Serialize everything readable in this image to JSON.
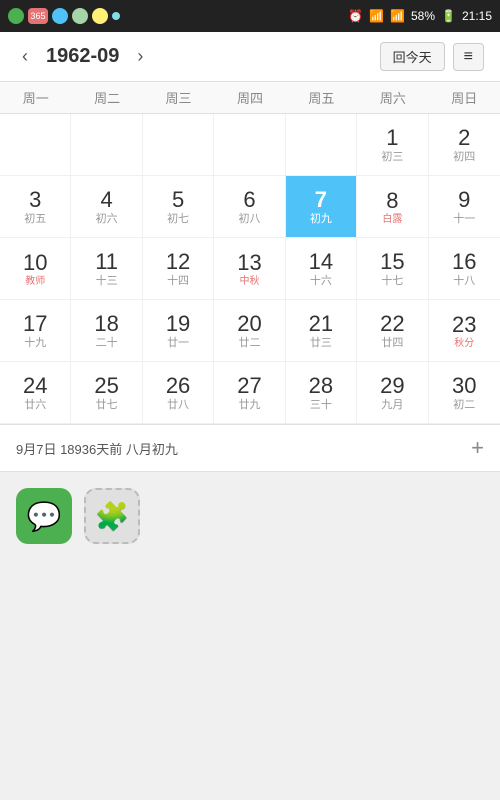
{
  "statusBar": {
    "time": "21:15",
    "battery": "58%",
    "icons": [
      "365",
      "?",
      "leaf",
      "face",
      "wifi"
    ]
  },
  "header": {
    "prevArrow": "‹",
    "nextArrow": "›",
    "monthTitle": "1962-09",
    "todayBtn": "回今天",
    "menuBtn": "≡"
  },
  "weekdays": [
    "周一",
    "周二",
    "周三",
    "周四",
    "周五",
    "周六",
    "周日"
  ],
  "infoBar": {
    "text": "9月7日 18936天前 八月初九",
    "addBtn": "+"
  },
  "days": [
    {
      "num": "",
      "lunar": "",
      "empty": true
    },
    {
      "num": "",
      "lunar": "",
      "empty": true
    },
    {
      "num": "",
      "lunar": "",
      "empty": true
    },
    {
      "num": "",
      "lunar": "",
      "empty": true
    },
    {
      "num": "",
      "lunar": "",
      "empty": true
    },
    {
      "num": "1",
      "lunar": "初三"
    },
    {
      "num": "2",
      "lunar": "初四"
    },
    {
      "num": "3",
      "lunar": "初五"
    },
    {
      "num": "4",
      "lunar": "初六"
    },
    {
      "num": "5",
      "lunar": "初七"
    },
    {
      "num": "6",
      "lunar": "初八"
    },
    {
      "num": "7",
      "lunar": "初九",
      "today": true
    },
    {
      "num": "8",
      "lunar": "白露",
      "festival": "白露"
    },
    {
      "num": "9",
      "lunar": "十一"
    },
    {
      "num": "10",
      "lunar": "教师",
      "festival": "教师"
    },
    {
      "num": "11",
      "lunar": "十三"
    },
    {
      "num": "12",
      "lunar": "十四"
    },
    {
      "num": "13",
      "lunar": "中秋",
      "festival": "中秋"
    },
    {
      "num": "14",
      "lunar": "十六"
    },
    {
      "num": "15",
      "lunar": "十七"
    },
    {
      "num": "16",
      "lunar": "十八"
    },
    {
      "num": "17",
      "lunar": "十九"
    },
    {
      "num": "18",
      "lunar": "二十"
    },
    {
      "num": "19",
      "lunar": "廿一"
    },
    {
      "num": "20",
      "lunar": "廿二"
    },
    {
      "num": "21",
      "lunar": "廿三"
    },
    {
      "num": "22",
      "lunar": "廿四"
    },
    {
      "num": "23",
      "lunar": "秋分",
      "festival": "秋分"
    },
    {
      "num": "24",
      "lunar": "廿六"
    },
    {
      "num": "25",
      "lunar": "廿七"
    },
    {
      "num": "26",
      "lunar": "廿八"
    },
    {
      "num": "27",
      "lunar": "廿九"
    },
    {
      "num": "28",
      "lunar": "三十"
    },
    {
      "num": "29",
      "lunar": "九月"
    },
    {
      "num": "30",
      "lunar": "初二"
    }
  ],
  "appIcons": [
    {
      "name": "微信",
      "type": "wechat",
      "symbol": "💬"
    },
    {
      "name": "拼图",
      "type": "puzzle",
      "symbol": "🧩"
    }
  ]
}
